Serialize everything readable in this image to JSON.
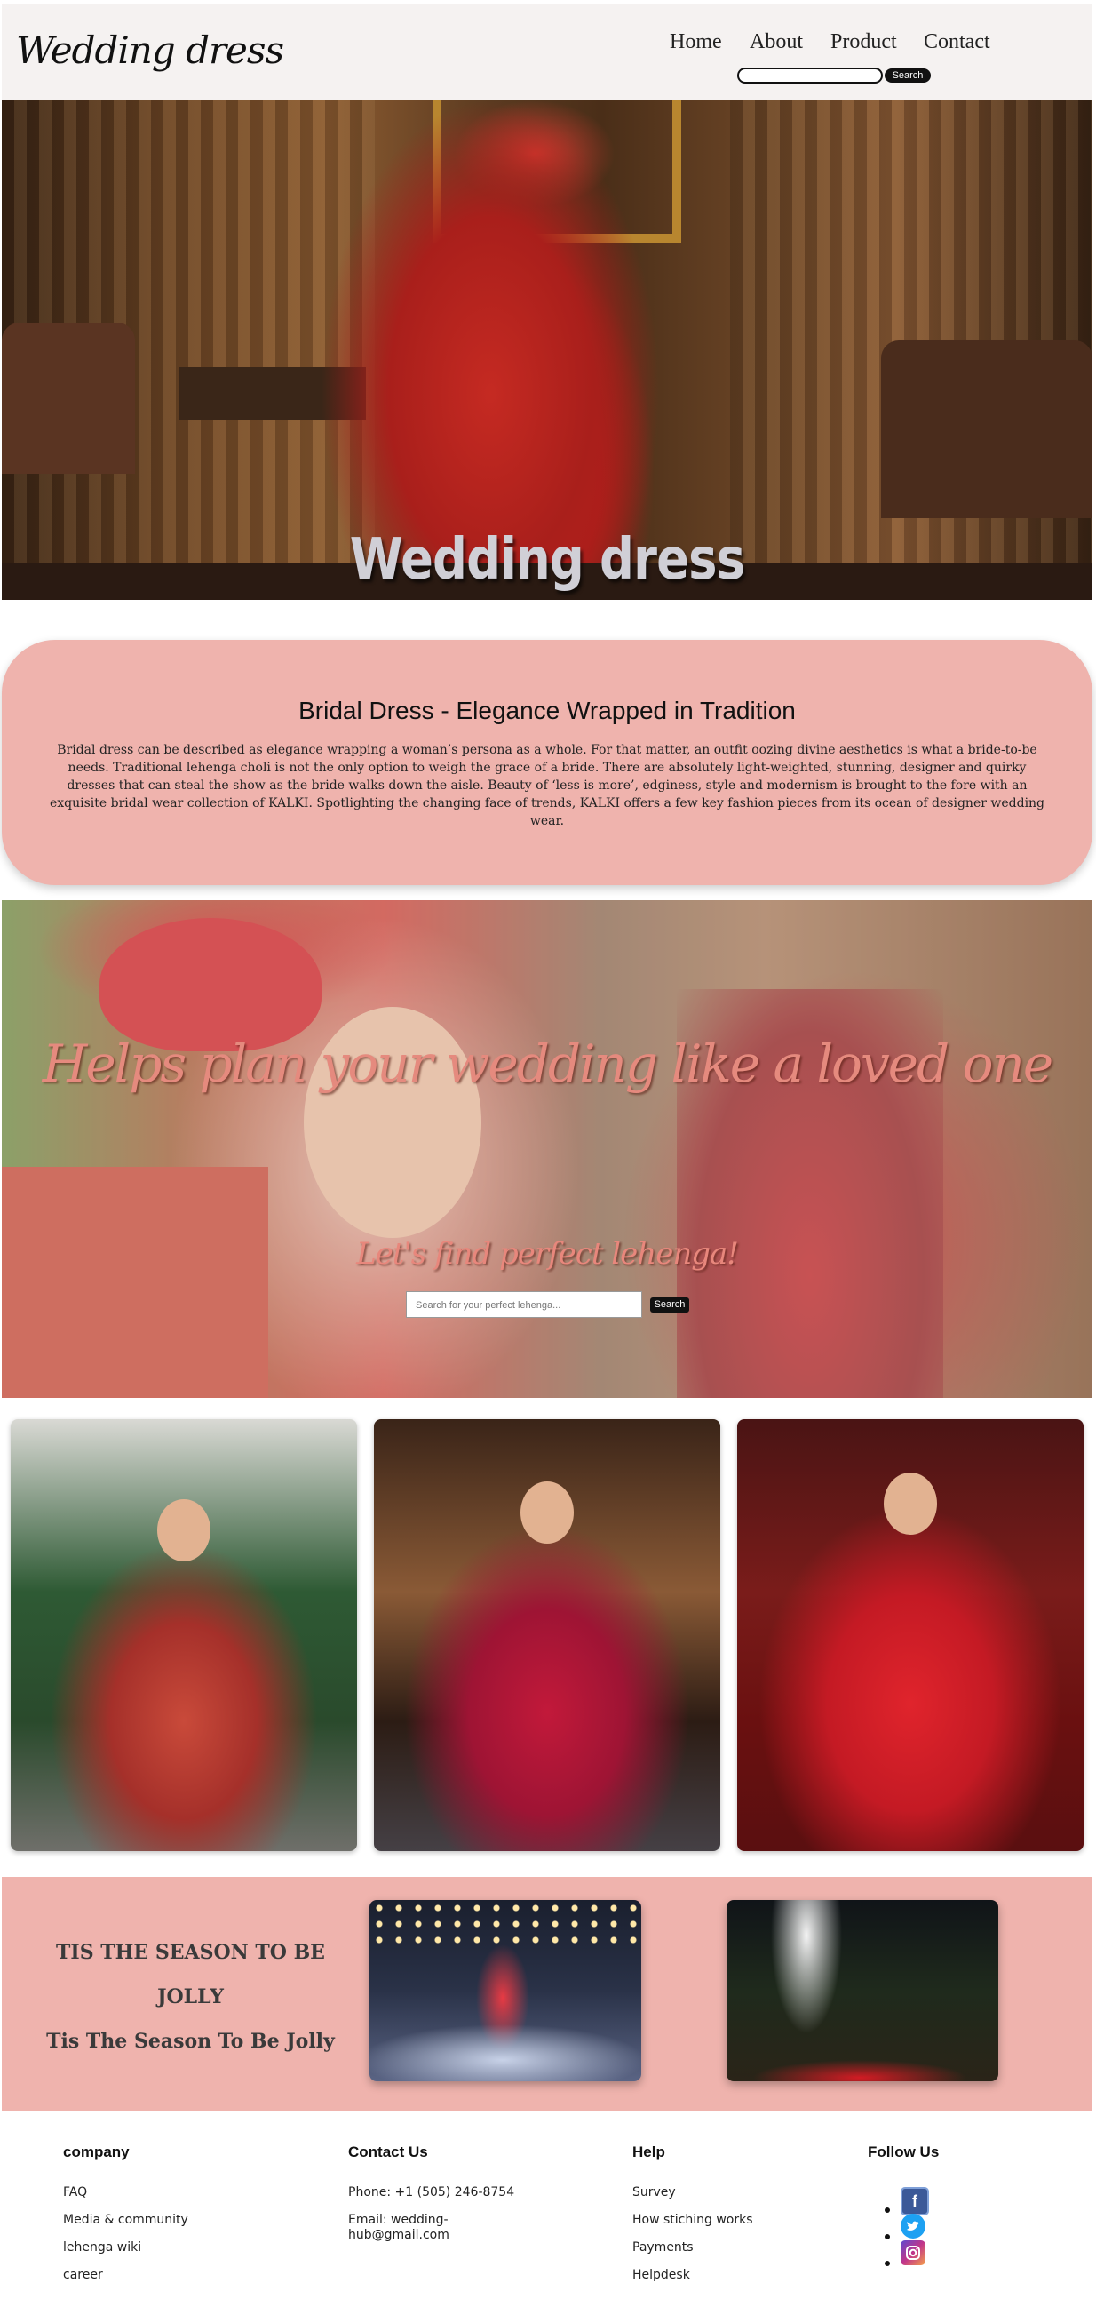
{
  "header": {
    "logo": "Wedding dress",
    "nav": [
      "Home",
      "About",
      "Product",
      "Contact"
    ],
    "search_button": "Search"
  },
  "hero": {
    "title": "Wedding dress"
  },
  "bridal": {
    "title": "Bridal Dress - Elegance Wrapped in Tradition",
    "text": "Bridal dress can be described as elegance wrapping a woman’s persona as a whole. For that matter, an outfit oozing divine aesthetics is what a bride-to-be needs. Traditional lehenga choli is not the only option to weigh the grace of a bride. There are absolutely light-weighted, stunning, designer and quirky dresses that can steal the show as the bride walks down the aisle. Beauty of ‘less is more’, edginess, style and modernism is brought to the fore with an exquisite bridal wear collection of KALKI. Spotlighting the changing face of trends, KALKI offers a few key fashion pieces from its ocean of designer wedding wear."
  },
  "plan": {
    "title": "Helps plan your wedding like a loved one",
    "subtitle": "Let's find perfect lehenga!",
    "search_placeholder": "Search for your perfect lehenga...",
    "search_button": "Search"
  },
  "season": {
    "line1": "TIS THE SEASON TO BE JOLLY",
    "line2": "Tis The Season To Be Jolly"
  },
  "footer": {
    "company": {
      "heading": "company",
      "items": [
        "FAQ",
        "Media & community",
        "lehenga wiki",
        "career"
      ]
    },
    "contact": {
      "heading": "Contact Us",
      "phone": "Phone: +1 (505) 246-8754",
      "email": "Email: wedding-hub@gmail.com"
    },
    "help": {
      "heading": "Help",
      "items": [
        "Survey",
        "How stiching works",
        "Payments",
        "Helpdesk"
      ]
    },
    "follow": {
      "heading": "Follow Us",
      "icons": [
        "facebook-icon",
        "twitter-icon",
        "instagram-icon"
      ]
    }
  },
  "colors": {
    "pink_section": "#efb3ad",
    "header_bg": "#f5f2f1",
    "facebook": "#3b5998",
    "twitter": "#1da1f2",
    "instagram": "#c1358a"
  }
}
